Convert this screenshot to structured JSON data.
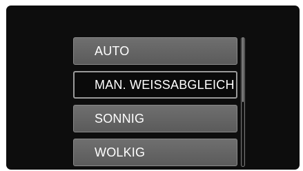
{
  "menu": {
    "items": [
      {
        "label": "AUTO",
        "selected": false
      },
      {
        "label": "MAN. WEISSABGLEICH",
        "selected": true
      },
      {
        "label": "SONNIG",
        "selected": false
      },
      {
        "label": "WOLKIG",
        "selected": false
      }
    ]
  },
  "scrollbar": {
    "thumb_start_fraction": 0.0,
    "thumb_size_fraction": 0.5
  },
  "colors": {
    "screen_background": "#0d0d0d",
    "item_background": "#666666",
    "selected_background": "#0a0a0a",
    "text": "#ffffff"
  }
}
